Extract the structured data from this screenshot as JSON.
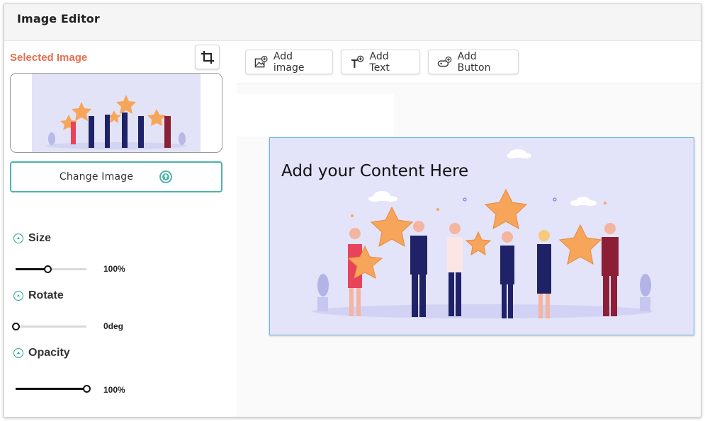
{
  "app": {
    "title": "Image Editor"
  },
  "sidebar": {
    "selected_label": "Selected Image",
    "change_image_label": "Change Image",
    "properties": [
      {
        "title": "Size",
        "value": "100%",
        "level": 0.45
      },
      {
        "title": "Rotate",
        "value": "0deg",
        "level": 0.0
      },
      {
        "title": "Opacity",
        "value": "100%",
        "level": 1.0
      }
    ]
  },
  "toolbar": {
    "add_image": "Add image",
    "add_text": "Add Text",
    "add_button": "Add Button"
  },
  "canvas": {
    "content_text": "Add your Content Here"
  },
  "colors": {
    "accent": "#e4704f",
    "teal": "#4fb3a9",
    "canvas_bg": "#e3e3f9",
    "star": "#f6a55a"
  }
}
